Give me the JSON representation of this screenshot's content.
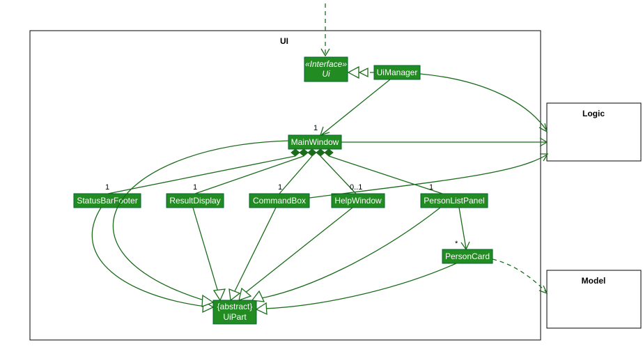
{
  "packages": {
    "ui": {
      "label": "UI"
    },
    "logic": {
      "label": "Logic"
    },
    "model": {
      "label": "Model"
    }
  },
  "classes": {
    "ui_interface": {
      "stereotype": "«Interface»",
      "name": "Ui"
    },
    "uimanager": {
      "name": "UiManager"
    },
    "mainwindow": {
      "name": "MainWindow"
    },
    "statusbarfooter": {
      "name": "StatusBarFooter"
    },
    "resultdisplay": {
      "name": "ResultDisplay"
    },
    "commandbox": {
      "name": "CommandBox"
    },
    "helpwindow": {
      "name": "HelpWindow"
    },
    "personlistpanel": {
      "name": "PersonListPanel"
    },
    "personcard": {
      "name": "PersonCard"
    },
    "uipart": {
      "modifier": "{abstract}",
      "name": "UiPart"
    }
  },
  "multiplicities": {
    "mainwindow": "1",
    "statusbarfooter": "1",
    "resultdisplay": "1",
    "commandbox": "1",
    "helpwindow": "0..1",
    "personlistpanel": "1",
    "personcard": "*"
  },
  "chart_data": {
    "type": "diagram",
    "diagram_kind": "UML class diagram",
    "packages": [
      "UI",
      "Logic",
      "Model"
    ],
    "classes": [
      {
        "name": "Ui",
        "stereotype": "interface",
        "package": "UI"
      },
      {
        "name": "UiManager",
        "package": "UI"
      },
      {
        "name": "MainWindow",
        "package": "UI"
      },
      {
        "name": "StatusBarFooter",
        "package": "UI"
      },
      {
        "name": "ResultDisplay",
        "package": "UI"
      },
      {
        "name": "CommandBox",
        "package": "UI"
      },
      {
        "name": "HelpWindow",
        "package": "UI"
      },
      {
        "name": "PersonListPanel",
        "package": "UI"
      },
      {
        "name": "PersonCard",
        "package": "UI"
      },
      {
        "name": "UiPart",
        "modifier": "abstract",
        "package": "UI"
      }
    ],
    "relationships": [
      {
        "from": "UiManager",
        "to": "Ui",
        "type": "realization"
      },
      {
        "from": "UiManager",
        "to": "MainWindow",
        "type": "association",
        "multiplicity_to": "1"
      },
      {
        "from": "MainWindow",
        "to": "StatusBarFooter",
        "type": "composition",
        "multiplicity_to": "1"
      },
      {
        "from": "MainWindow",
        "to": "ResultDisplay",
        "type": "composition",
        "multiplicity_to": "1"
      },
      {
        "from": "MainWindow",
        "to": "CommandBox",
        "type": "composition",
        "multiplicity_to": "1"
      },
      {
        "from": "MainWindow",
        "to": "HelpWindow",
        "type": "composition",
        "multiplicity_to": "0..1"
      },
      {
        "from": "MainWindow",
        "to": "PersonListPanel",
        "type": "composition",
        "multiplicity_to": "1"
      },
      {
        "from": "PersonListPanel",
        "to": "PersonCard",
        "type": "association",
        "multiplicity_to": "*"
      },
      {
        "from": "MainWindow",
        "to": "UiPart",
        "type": "generalization"
      },
      {
        "from": "StatusBarFooter",
        "to": "UiPart",
        "type": "generalization"
      },
      {
        "from": "ResultDisplay",
        "to": "UiPart",
        "type": "generalization"
      },
      {
        "from": "CommandBox",
        "to": "UiPart",
        "type": "generalization"
      },
      {
        "from": "HelpWindow",
        "to": "UiPart",
        "type": "generalization"
      },
      {
        "from": "PersonListPanel",
        "to": "UiPart",
        "type": "generalization"
      },
      {
        "from": "PersonCard",
        "to": "UiPart",
        "type": "generalization"
      },
      {
        "from": "(external)",
        "to": "Ui",
        "type": "dependency"
      },
      {
        "from": "UiManager",
        "to": "Logic",
        "type": "association"
      },
      {
        "from": "MainWindow",
        "to": "Logic",
        "type": "association"
      },
      {
        "from": "CommandBox",
        "to": "Logic",
        "type": "association"
      },
      {
        "from": "PersonCard",
        "to": "Model",
        "type": "dependency"
      }
    ]
  }
}
